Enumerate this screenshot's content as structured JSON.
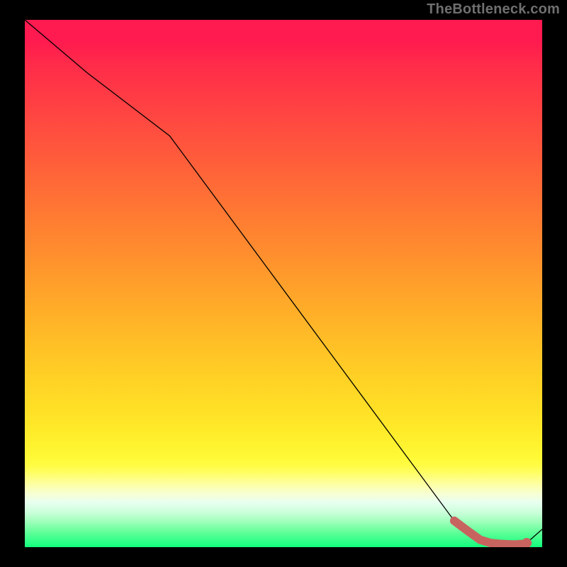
{
  "watermark": "TheBottleneck.com",
  "chart_data": {
    "type": "line",
    "title": "",
    "xlabel": "",
    "ylabel": "",
    "xlim": [
      0,
      100
    ],
    "ylim": [
      0,
      100
    ],
    "grid": false,
    "legend": false,
    "series": [
      {
        "name": "main-curve",
        "color": "#000000",
        "thin_width": 1.3,
        "x": [
          0,
          12,
          28,
          83,
          86,
          88,
          90,
          92,
          94,
          95,
          96,
          97,
          100
        ],
        "values": [
          100,
          90,
          78,
          5,
          2.8,
          1.4,
          0.8,
          0.6,
          0.5,
          0.5,
          0.6,
          0.8,
          3.4
        ]
      }
    ],
    "thick_segment": {
      "color": "#c8645f",
      "width": 12,
      "linecap": "round",
      "x": [
        83,
        86,
        88,
        90,
        92,
        94,
        95,
        96
      ],
      "values": [
        5.0,
        2.8,
        1.4,
        0.8,
        0.6,
        0.5,
        0.5,
        0.6
      ]
    },
    "end_marker": {
      "color": "#c8645f",
      "radius": 7,
      "x": 97,
      "value": 0.8
    },
    "background_gradient": {
      "description": "vertical stoplight gradient, red→orange→yellow→pale→green",
      "stops": [
        {
          "pos": 0.0,
          "hex": "#ff1a4f"
        },
        {
          "pos": 0.5,
          "hex": "#ff9f2b"
        },
        {
          "pos": 0.8,
          "hex": "#ffee2b"
        },
        {
          "pos": 0.9,
          "hex": "#f6ffd6"
        },
        {
          "pos": 1.0,
          "hex": "#12ff7e"
        }
      ]
    }
  }
}
